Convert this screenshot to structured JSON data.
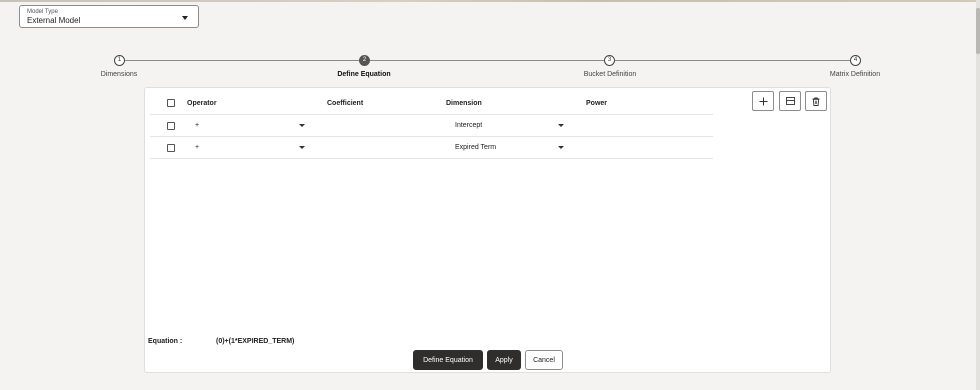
{
  "model_type": {
    "label": "Model Type",
    "value": "External Model"
  },
  "stepper": {
    "steps": [
      {
        "number": "1",
        "label": "Dimensions"
      },
      {
        "number": "2",
        "label": "Define Equation"
      },
      {
        "number": "3",
        "label": "Bucket Definition"
      },
      {
        "number": "4",
        "label": "Matrix Definition"
      }
    ],
    "active_step": 2
  },
  "table": {
    "headers": {
      "operator": "Operator",
      "coefficient": "Coefficient",
      "dimension": "Dimension",
      "power": "Power"
    },
    "rows": [
      {
        "operator": "+",
        "coefficient": "",
        "dimension": "Intercept",
        "power": ""
      },
      {
        "operator": "+",
        "coefficient": "",
        "dimension": "Expired Term",
        "power": ""
      }
    ]
  },
  "toolbar": {
    "icons": [
      "plus-icon",
      "form-icon",
      "trash-icon"
    ]
  },
  "equation": {
    "label": "Equation :",
    "value": "(0)+(1*EXPIRED_TERM)"
  },
  "buttons": {
    "define_equation": "Define Equation",
    "apply": "Apply",
    "cancel": "Cancel"
  },
  "colors": {
    "dark_button": "#2f2e2c",
    "active_step": "#555555",
    "background": "#f4f3f1"
  }
}
